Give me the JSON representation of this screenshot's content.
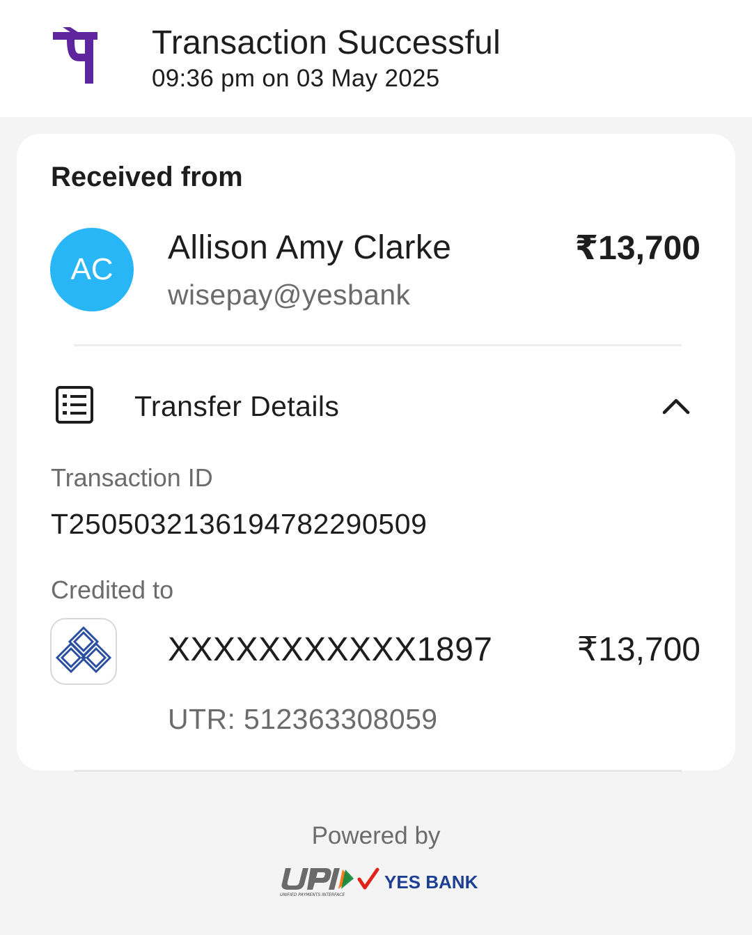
{
  "header": {
    "title": "Transaction Successful",
    "datetime": "09:36 pm on 03 May 2025",
    "brand_color": "#5f259f"
  },
  "card": {
    "received_label": "Received from",
    "sender": {
      "initials": "AC",
      "name": "Allison Amy Clarke",
      "vpa": "wisepay@yesbank",
      "amount": "₹13,700",
      "avatar_color": "#29b6f6"
    },
    "transfer_details": {
      "title": "Transfer Details",
      "icon": "receipt-list-icon",
      "toggle_icon": "chevron-up-icon",
      "transaction_id_label": "Transaction ID",
      "transaction_id": "T2505032136194782290509",
      "credited_to_label": "Credited to",
      "account": "XXXXXXXXXXX1897",
      "credited_amount": "₹13,700",
      "utr": "UTR: 512363308059",
      "bank_icon": "bank-logo-icon"
    }
  },
  "footer": {
    "powered_by": "Powered by",
    "logos": [
      "upi-logo",
      "yes-bank-logo"
    ]
  }
}
